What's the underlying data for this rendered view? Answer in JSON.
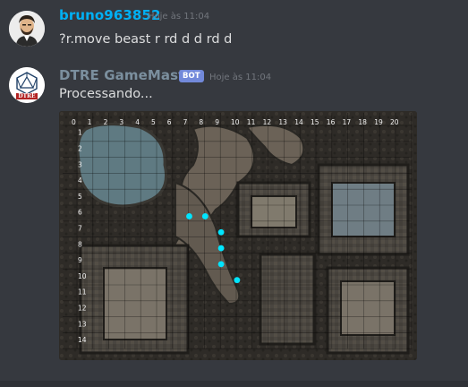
{
  "messages": [
    {
      "username": "bruno963852",
      "username_color": "#00b0f4",
      "timestamp": "Hoje às 11:04",
      "content": "?r.move beast r rd d d rd d"
    },
    {
      "username": "DTRE GameMaster",
      "username_color": "#7b8f9e",
      "bot_tag": "BOT",
      "timestamp": "Hoje às 11:04",
      "content": "Processando...",
      "avatar_text": "DTRE"
    }
  ],
  "map": {
    "col_labels": [
      "0",
      "1",
      "2",
      "3",
      "4",
      "5",
      "6",
      "7",
      "8",
      "9",
      "10",
      "11",
      "12",
      "13",
      "14",
      "15",
      "16",
      "17",
      "18",
      "19",
      "20"
    ],
    "row_labels": [
      "1",
      "2",
      "3",
      "4",
      "5",
      "6",
      "7",
      "8",
      "9",
      "10",
      "11",
      "12",
      "13",
      "14"
    ],
    "path_points": [
      {
        "x": 7.5,
        "y": 6
      },
      {
        "x": 8.5,
        "y": 6
      },
      {
        "x": 9.5,
        "y": 7
      },
      {
        "x": 9.5,
        "y": 8
      },
      {
        "x": 9.5,
        "y": 9
      },
      {
        "x": 10.5,
        "y": 10
      }
    ],
    "dot_color": "#00e5ff"
  }
}
